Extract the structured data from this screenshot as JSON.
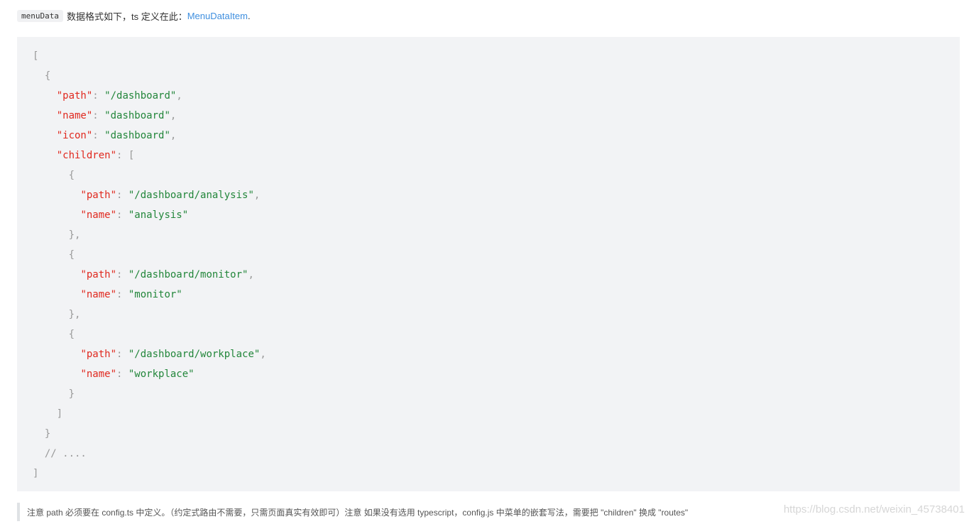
{
  "intro": {
    "code": "menuData",
    "text": "数据格式如下，ts 定义在此：",
    "link": "MenuDataItem",
    "suffix": "."
  },
  "code_lines": [
    [
      [
        "p",
        "["
      ]
    ],
    [
      [
        "p",
        "  {"
      ]
    ],
    [
      [
        "p",
        "    "
      ],
      [
        "k",
        "\"path\""
      ],
      [
        "p",
        ": "
      ],
      [
        "s",
        "\"/dashboard\""
      ],
      [
        "p",
        ","
      ]
    ],
    [
      [
        "p",
        "    "
      ],
      [
        "k",
        "\"name\""
      ],
      [
        "p",
        ": "
      ],
      [
        "s",
        "\"dashboard\""
      ],
      [
        "p",
        ","
      ]
    ],
    [
      [
        "p",
        "    "
      ],
      [
        "k",
        "\"icon\""
      ],
      [
        "p",
        ": "
      ],
      [
        "s",
        "\"dashboard\""
      ],
      [
        "p",
        ","
      ]
    ],
    [
      [
        "p",
        "    "
      ],
      [
        "k",
        "\"children\""
      ],
      [
        "p",
        ": ["
      ]
    ],
    [
      [
        "p",
        "      {"
      ]
    ],
    [
      [
        "p",
        "        "
      ],
      [
        "k",
        "\"path\""
      ],
      [
        "p",
        ": "
      ],
      [
        "s",
        "\"/dashboard/analysis\""
      ],
      [
        "p",
        ","
      ]
    ],
    [
      [
        "p",
        "        "
      ],
      [
        "k",
        "\"name\""
      ],
      [
        "p",
        ": "
      ],
      [
        "s",
        "\"analysis\""
      ]
    ],
    [
      [
        "p",
        "      },"
      ]
    ],
    [
      [
        "p",
        "      {"
      ]
    ],
    [
      [
        "p",
        "        "
      ],
      [
        "k",
        "\"path\""
      ],
      [
        "p",
        ": "
      ],
      [
        "s",
        "\"/dashboard/monitor\""
      ],
      [
        "p",
        ","
      ]
    ],
    [
      [
        "p",
        "        "
      ],
      [
        "k",
        "\"name\""
      ],
      [
        "p",
        ": "
      ],
      [
        "s",
        "\"monitor\""
      ]
    ],
    [
      [
        "p",
        "      },"
      ]
    ],
    [
      [
        "p",
        "      {"
      ]
    ],
    [
      [
        "p",
        "        "
      ],
      [
        "k",
        "\"path\""
      ],
      [
        "p",
        ": "
      ],
      [
        "s",
        "\"/dashboard/workplace\""
      ],
      [
        "p",
        ","
      ]
    ],
    [
      [
        "p",
        "        "
      ],
      [
        "k",
        "\"name\""
      ],
      [
        "p",
        ": "
      ],
      [
        "s",
        "\"workplace\""
      ]
    ],
    [
      [
        "p",
        "      }"
      ]
    ],
    [
      [
        "p",
        "    ]"
      ]
    ],
    [
      [
        "p",
        "  }"
      ]
    ],
    [
      [
        "c",
        "  // ...."
      ]
    ],
    [
      [
        "p",
        "]"
      ]
    ]
  ],
  "note": "注意 path 必须要在 config.ts 中定义。（约定式路由不需要，只需页面真实有效即可）注意 如果没有选用 typescript，config.js 中菜单的嵌套写法，需要把 \"children\" 换成 \"routes\"",
  "watermark": "https://blog.csdn.net/weixin_45738401",
  "colors": {
    "key": "#e0291f",
    "string": "#22863a",
    "punct": "#999999",
    "link": "#3f8fdf",
    "code_bg": "#f2f3f5"
  }
}
